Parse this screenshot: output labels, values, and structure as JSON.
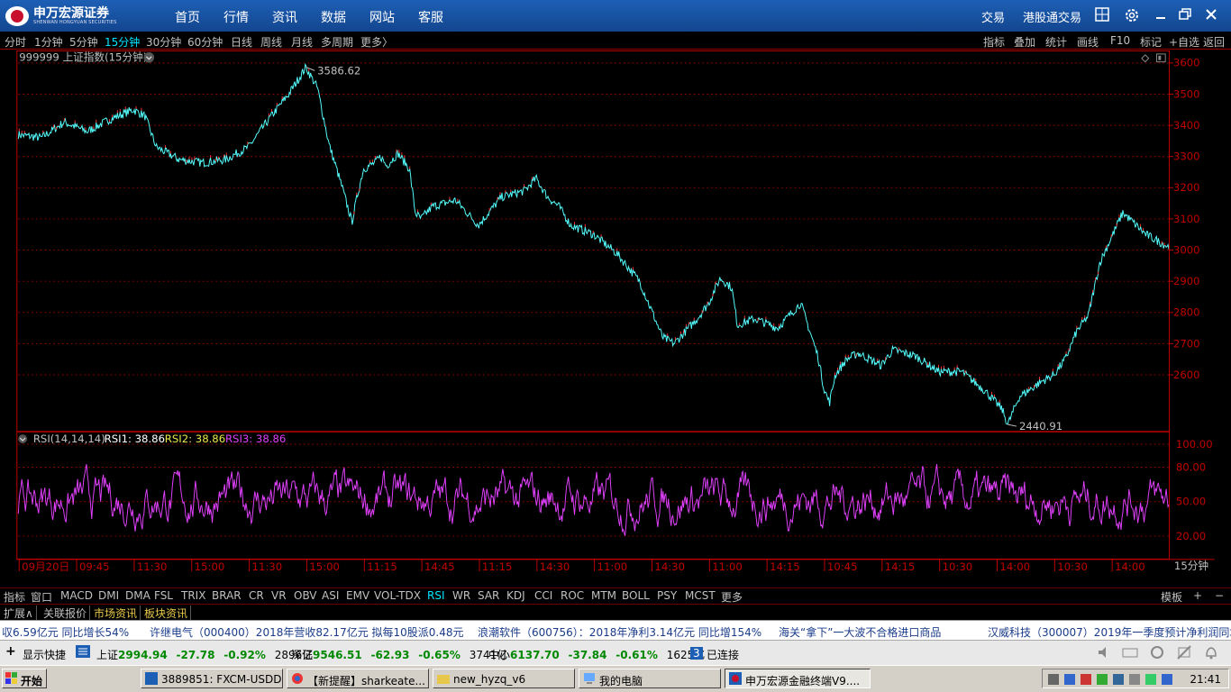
{
  "app": {
    "logo_title": "申万宏源证券",
    "logo_subtitle": "SHENWAN HONGYUAN SECURITIES"
  },
  "menu": {
    "items": [
      "首页",
      "行情",
      "资讯",
      "数据",
      "网站",
      "客服"
    ],
    "right_items": [
      "交易",
      "港股通交易"
    ]
  },
  "periods": {
    "items": [
      "分时",
      "1分钟",
      "5分钟",
      "15分钟",
      "30分钟",
      "60分钟",
      "日线",
      "周线",
      "月线",
      "多周期",
      "更多〉"
    ],
    "active": "15分钟"
  },
  "chart_tools": [
    "指标",
    "叠加",
    "统计",
    "画线",
    "F10",
    "标记",
    "+自选",
    "返回"
  ],
  "chart_data": [
    {
      "type": "line",
      "title": "999999 上证指数(15分钟)",
      "y_ticks": [
        3600,
        3500,
        3400,
        3300,
        3200,
        3100,
        3000,
        2900,
        2800,
        2700,
        2600
      ],
      "ylim": [
        2420,
        3640
      ],
      "high_label": "3586.62",
      "low_label": "2440.91",
      "series": [
        {
          "x": [
            0,
            0.02,
            0.04,
            0.06,
            0.08,
            0.1,
            0.11,
            0.12,
            0.14,
            0.16,
            0.18,
            0.2,
            0.22,
            0.235,
            0.25,
            0.26,
            0.27,
            0.28,
            0.29,
            0.295,
            0.3,
            0.31,
            0.315,
            0.32,
            0.33,
            0.34,
            0.345,
            0.35,
            0.36,
            0.38,
            0.4,
            0.42,
            0.44,
            0.45,
            0.46,
            0.47,
            0.48,
            0.5,
            0.52,
            0.54,
            0.56,
            0.57,
            0.59,
            0.6,
            0.61,
            0.62,
            0.625,
            0.64,
            0.66,
            0.68,
            0.695,
            0.7,
            0.705,
            0.71,
            0.72,
            0.73,
            0.75,
            0.76,
            0.78,
            0.8,
            0.82,
            0.84,
            0.855,
            0.86,
            0.87,
            0.89,
            0.9,
            0.91,
            0.92,
            0.93,
            0.94,
            0.96,
            0.98,
            1.0
          ],
          "values": [
            3370,
            3360,
            3410,
            3380,
            3420,
            3450,
            3430,
            3330,
            3290,
            3280,
            3290,
            3330,
            3430,
            3500,
            3586,
            3520,
            3340,
            3220,
            3090,
            3180,
            3260,
            3280,
            3300,
            3270,
            3310,
            3260,
            3120,
            3100,
            3140,
            3160,
            3080,
            3170,
            3190,
            3230,
            3170,
            3140,
            3080,
            3050,
            2990,
            2900,
            2720,
            2700,
            2780,
            2830,
            2910,
            2880,
            2760,
            2780,
            2750,
            2830,
            2660,
            2560,
            2510,
            2600,
            2650,
            2670,
            2630,
            2680,
            2660,
            2610,
            2610,
            2550,
            2490,
            2441,
            2530,
            2580,
            2600,
            2650,
            2740,
            2790,
            2960,
            3120,
            3050,
            3010
          ]
        }
      ]
    },
    {
      "type": "line",
      "title": "RSI(14,14,14)",
      "legend": [
        {
          "name": "RSI1: 38.86",
          "color": "#ffffff"
        },
        {
          "name": "RSI2: 38.86",
          "color": "#e8e84a"
        },
        {
          "name": "RSI3: 38.86",
          "color": "#e040fb"
        }
      ],
      "y_ticks": [
        100.0,
        80.0,
        50.0,
        20.0
      ],
      "ylim": [
        0,
        110
      ]
    }
  ],
  "x_axis_labels": [
    "09月20日",
    "09:45",
    "11:30",
    "15:00",
    "11:30",
    "15:00",
    "11:15",
    "14:45",
    "11:15",
    "14:30",
    "11:00",
    "14:30",
    "11:00",
    "14:15",
    "10:45",
    "14:15",
    "10:30",
    "14:00",
    "10:30",
    "14:00"
  ],
  "period_label": "15分钟",
  "indicator_tabs": {
    "items": [
      "指标",
      "窗口",
      "MACD",
      "DMI",
      "DMA",
      "FSL",
      "TRIX",
      "BRAR",
      "CR",
      "VR",
      "OBV",
      "ASI",
      "EMV",
      "VOL-TDX",
      "RSI",
      "WR",
      "SAR",
      "KDJ",
      "CCI",
      "ROC",
      "MTM",
      "BOLL",
      "PSY",
      "MCST",
      "更多"
    ],
    "active": "RSI",
    "right": [
      "模板",
      "+",
      "−"
    ]
  },
  "ext_tabs": [
    "扩展∧",
    "关联报价",
    "市场资讯",
    "板块资讯"
  ],
  "ticker": [
    "収6.59亿元  同比增长54%",
    "许继电气（000400）2018年营收82.17亿元  拟每10股派0.48元",
    "浪潮软件（600756）：2018年净利3.14亿元  同比增154%",
    "海关“拿下”一大波不合格进口商品",
    "汉威科技（300007）2019年一季度预计净利润同增"
  ],
  "status": {
    "show_quick": "显示快捷",
    "sh_name": "上证",
    "sh_price": "2994.94",
    "sh_chg": "-27.78",
    "sh_pct": "-0.92%",
    "sh_amt": "2896亿",
    "sz_name": "深证",
    "sz_price": "9546.51",
    "sz_chg": "-62.93",
    "sz_pct": "-0.65%",
    "sz_amt": "3741亿",
    "zx_name": "中小",
    "zx_price": "6137.70",
    "zx_chg": "-37.84",
    "zx_pct": "-0.61%",
    "zx_amt": "1625亿",
    "conn_num": "3",
    "conn_text": "已连接"
  },
  "taskbar": {
    "start": "开始",
    "tasks": [
      "3889851: FXCM-USDDe...",
      "【新提醒】sharkeate...",
      "new_hyzq_v6",
      "我的电脑",
      "申万宏源金融终端V9...."
    ],
    "clock": "21:41"
  },
  "colors": {
    "up": "#ff3232",
    "down": "#54ffff",
    "rsi": "#e040fb",
    "grid": "#8b0000",
    "axis": "#c00000"
  }
}
